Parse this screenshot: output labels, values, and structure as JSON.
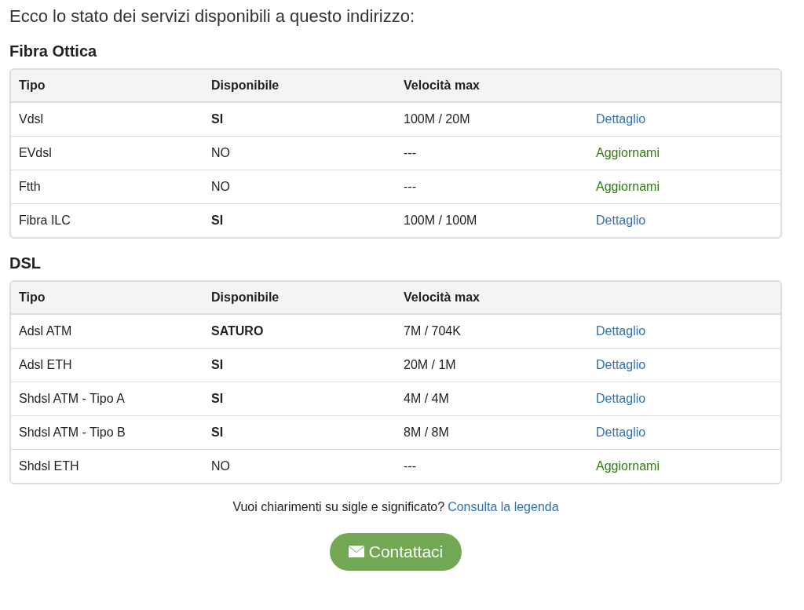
{
  "intro": "Ecco lo stato dei servizi disponibili a questo indirizzo:",
  "sections": [
    {
      "title": "Fibra Ottica",
      "columns": [
        "Tipo",
        "Disponibile",
        "Velocità max"
      ],
      "rows": [
        {
          "type": "Vdsl",
          "available": "SI",
          "emphasized": true,
          "speed": "100M / 20M",
          "action": {
            "label": "Dettaglio",
            "kind": "detail"
          }
        },
        {
          "type": "EVdsl",
          "available": "NO",
          "emphasized": false,
          "speed": "---",
          "action": {
            "label": "Aggiornami",
            "kind": "upgrade"
          }
        },
        {
          "type": "Ftth",
          "available": "NO",
          "emphasized": false,
          "speed": "---",
          "action": {
            "label": "Aggiornami",
            "kind": "upgrade"
          }
        },
        {
          "type": "Fibra ILC",
          "available": "SI",
          "emphasized": true,
          "speed": "100M / 100M",
          "action": {
            "label": "Dettaglio",
            "kind": "detail"
          }
        }
      ]
    },
    {
      "title": "DSL",
      "columns": [
        "Tipo",
        "Disponibile",
        "Velocità max"
      ],
      "rows": [
        {
          "type": "Adsl ATM",
          "available": "SATURO",
          "emphasized": true,
          "speed": "7M / 704K",
          "action": {
            "label": "Dettaglio",
            "kind": "detail"
          }
        },
        {
          "type": "Adsl ETH",
          "available": "SI",
          "emphasized": true,
          "speed": "20M / 1M",
          "action": {
            "label": "Dettaglio",
            "kind": "detail"
          }
        },
        {
          "type": "Shdsl ATM - Tipo A",
          "available": "SI",
          "emphasized": true,
          "speed": "4M / 4M",
          "action": {
            "label": "Dettaglio",
            "kind": "detail"
          }
        },
        {
          "type": "Shdsl ATM - Tipo B",
          "available": "SI",
          "emphasized": true,
          "speed": "8M / 8M",
          "action": {
            "label": "Dettaglio",
            "kind": "detail"
          }
        },
        {
          "type": "Shdsl ETH",
          "available": "NO",
          "emphasized": false,
          "speed": "---",
          "action": {
            "label": "Aggiornami",
            "kind": "upgrade"
          }
        }
      ]
    }
  ],
  "legend": {
    "question": "Vuoi chiarimenti su sigle e significato?",
    "link": "Consulta la legenda"
  },
  "contact_button": "Contattaci"
}
